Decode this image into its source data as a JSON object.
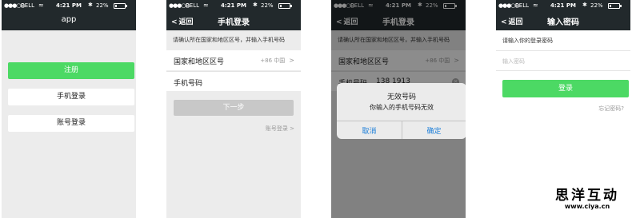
{
  "status_bar": {
    "signal": "●●●○○",
    "carrier": "BELL",
    "wifi": "≈",
    "time": "4:21 PM",
    "bluetooth": "✱",
    "battery_pct": "22%",
    "battery_level": 0.22
  },
  "screen1": {
    "app_title": "app",
    "register_label": "注册",
    "phone_login_label": "手机登录",
    "account_login_label": "账号登录"
  },
  "screen2": {
    "back_label": "返回",
    "title": "手机登录",
    "hint": "请确认所在国家和地区区号，并输入手机号码",
    "country_label": "国家和地区区号",
    "country_value": "+86 中国",
    "phone_label": "手机号码",
    "next_label": "下一步",
    "account_login_link": "账号登录 >"
  },
  "screen3": {
    "back_label": "返回",
    "title": "手机登录",
    "hint": "请确认所在国家和地区区号，并输入手机号码",
    "country_label": "国家和地区区号",
    "country_value": "+86 中国",
    "phone_label": "手机号码",
    "phone_value": "138 1913",
    "dialog": {
      "title": "无效号码",
      "message": "你输入的手机号码无效",
      "cancel_label": "取消",
      "confirm_label": "确定"
    }
  },
  "screen4": {
    "back_label": "返回",
    "title": "输入密码",
    "hint": "请输入你的登录密码",
    "password_placeholder": "输入密码",
    "login_label": "登录",
    "forgot_label": "忘记密码?"
  },
  "watermark": {
    "brand": "思洋互动",
    "url": "www.ciya.cn"
  },
  "colors": {
    "navbar": "#22292c",
    "green": "#4cd964",
    "dialog_button": "#1a7dd8",
    "background": "#ececec"
  },
  "icons": {
    "back": "chevron-left-icon",
    "arrow": "chevron-right-icon",
    "clear": "clear-circle-icon",
    "wifi": "wifi-icon",
    "bluetooth": "bluetooth-icon",
    "battery": "battery-icon"
  }
}
